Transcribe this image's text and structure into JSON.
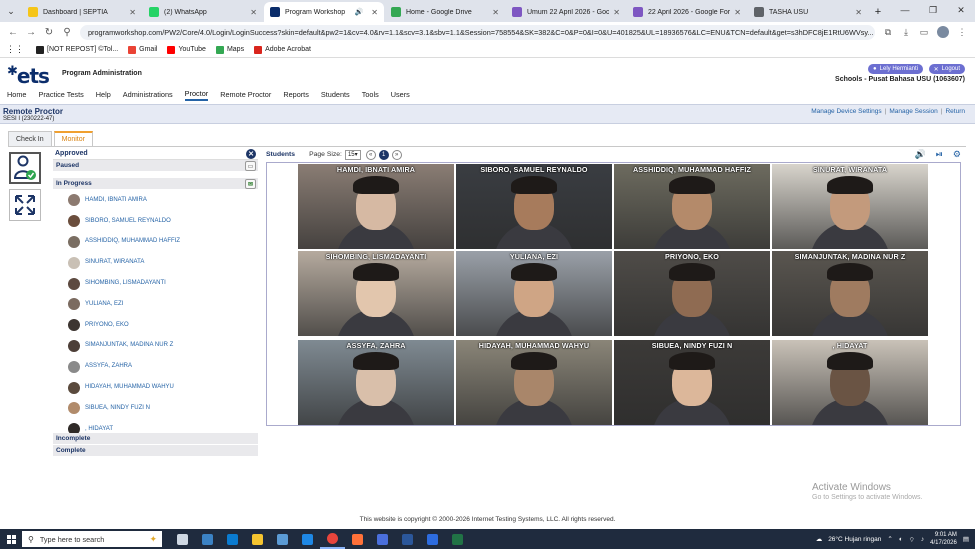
{
  "browser": {
    "tabs": [
      {
        "label": "Dashboard | SEPTIA",
        "icon_color": "#f5c518",
        "active": false,
        "audio": false
      },
      {
        "label": "(2) WhatsApp",
        "icon_color": "#25d366",
        "active": false,
        "audio": false
      },
      {
        "label": "Program Workshop",
        "icon_color": "#0b2d6b",
        "active": true,
        "audio": true
      },
      {
        "label": "Home - Google Drive",
        "icon_color": "#34a853",
        "active": false,
        "audio": false
      },
      {
        "label": "Umum 22 April 2026 - Google",
        "icon_color": "#7e57c2",
        "active": false,
        "audio": false
      },
      {
        "label": "22 April 2026 - Google Forms",
        "icon_color": "#7e57c2",
        "active": false,
        "audio": false
      },
      {
        "label": "TASHA USU",
        "icon_color": "#5f6368",
        "active": false,
        "audio": false
      }
    ],
    "url": "programworkshop.com/PW2/Core/4.0/Login/LoginSuccess?skin=default&pw2=1&cv=4.0&rv=1.1&scv=3.1&sbv=1.1&Session=758554&SK=382&C=0&P=0&I=0&U=401825&UL=18936576&LC=ENU&TCN=default&get=s3hDFC8jE1RtU6WVsy...",
    "bookmarks": [
      {
        "label": "[NOT REPOST] ©Tol...",
        "icon_color": "#222222"
      },
      {
        "label": "Gmail",
        "icon_color": "#ea4335"
      },
      {
        "label": "YouTube",
        "icon_color": "#ff0000"
      },
      {
        "label": "Maps",
        "icon_color": "#34a853"
      },
      {
        "label": "Adobe Acrobat",
        "icon_color": "#d9251d"
      }
    ]
  },
  "app": {
    "logo": "ets",
    "program": "Program Administration",
    "user": "Lely Hermianti",
    "logout": "Logout",
    "school": "Schools - Pusat Bahasa USU (1063607)",
    "nav": [
      "Home",
      "Practice Tests",
      "Help",
      "Administrations",
      "Proctor",
      "Remote Proctor",
      "Reports",
      "Students",
      "Tools",
      "Users"
    ],
    "nav_active": "Proctor"
  },
  "page": {
    "title": "Remote Proctor",
    "session": "SESI I (230222-47)",
    "links": [
      "Manage Device Settings",
      "Manage Session",
      "Return"
    ],
    "tabs": [
      "Check In",
      "Monitor"
    ],
    "active_tab": "Monitor"
  },
  "roster": {
    "title": "Approved",
    "sections": {
      "paused": "Paused",
      "in_progress": "In Progress",
      "incomplete": "Incomplete",
      "complete": "Complete"
    },
    "students": [
      "HAMDI, IBNATI AMIRA",
      "SIBORO, SAMUEL REYNALDO",
      "ASSHIDDIQ, MUHAMMAD HAFFIZ",
      "SINURAT, WIRANATA",
      "SIHOMBING, LISMADAYANTI",
      "YULIANA, EZI",
      "PRIYONO, EKO",
      "SIMANJUNTAK, MADINA NUR Z",
      "ASSYFA, ZAHRA",
      "HIDAYAH, MUHAMMAD WAHYU",
      "SIBUEA, NINDY FUZI N",
      ", HIDAYAT"
    ]
  },
  "students_panel": {
    "label": "Students",
    "page_size_label": "Page Size:",
    "page_size": "15",
    "current_page": "1",
    "tiles": [
      {
        "name": "HAMDI, IBNATI AMIRA",
        "bg": "#8a7d74",
        "face": "#d6b9a3"
      },
      {
        "name": "SIBORO, SAMUEL REYNALDO",
        "bg": "#3a3d42",
        "face": "#a77b5c"
      },
      {
        "name": "ASSHIDDIQ, MUHAMMAD HAFFIZ",
        "bg": "#6d6b5f",
        "face": "#b48a6a"
      },
      {
        "name": "SINURAT, WIRANATA",
        "bg": "#d8d4cc",
        "face": "#c39a7c"
      },
      {
        "name": "SIHOMBING, LISMADAYANTI",
        "bg": "#b5aa9e",
        "face": "#e2c6ad"
      },
      {
        "name": "YULIANA, EZI",
        "bg": "#9aa0a8",
        "face": "#cfa585"
      },
      {
        "name": "PRIYONO, EKO",
        "bg": "#4f4c48",
        "face": "#8f6b52"
      },
      {
        "name": "SIMANJUNTAK, MADINA NUR Z",
        "bg": "#5a5650",
        "face": "#9f7b60"
      },
      {
        "name": "ASSYFA, ZAHRA",
        "bg": "#7f8a92",
        "face": "#d9bfaa"
      },
      {
        "name": "HIDAYAH, MUHAMMAD WAHYU",
        "bg": "#8a8578",
        "face": "#a9866a"
      },
      {
        "name": "SIBUEA, NINDY FUZI N",
        "bg": "#3c3a38",
        "face": "#dcb79a"
      },
      {
        "name": ", HIDAYAT",
        "bg": "#c9c2b8",
        "face": "#6a5444"
      }
    ]
  },
  "footer": {
    "copyright": "This website is copyright © 2000-2026 Internet Testing Systems, LLC. All rights reserved.",
    "watermark_title": "Activate Windows",
    "watermark_sub": "Go to Settings to activate Windows."
  },
  "taskbar": {
    "search_placeholder": "Type here to search",
    "weather": "26°C  Hujan ringan",
    "time": "9:01 AM",
    "date": "4/17/2026",
    "apps": [
      {
        "color": "#cfd8e3"
      },
      {
        "color": "#3b82c4"
      },
      {
        "color": "#0a7bd0"
      },
      {
        "color": "#f4c430"
      },
      {
        "color": "#5b9bd5"
      },
      {
        "color": "#1e88e5"
      },
      {
        "color": "#e8453c"
      },
      {
        "color": "#ff7139"
      },
      {
        "color": "#4a6fdc"
      },
      {
        "color": "#2b579a"
      },
      {
        "color": "#2d6cdf"
      },
      {
        "color": "#217346"
      }
    ],
    "active_app_index": 6
  }
}
